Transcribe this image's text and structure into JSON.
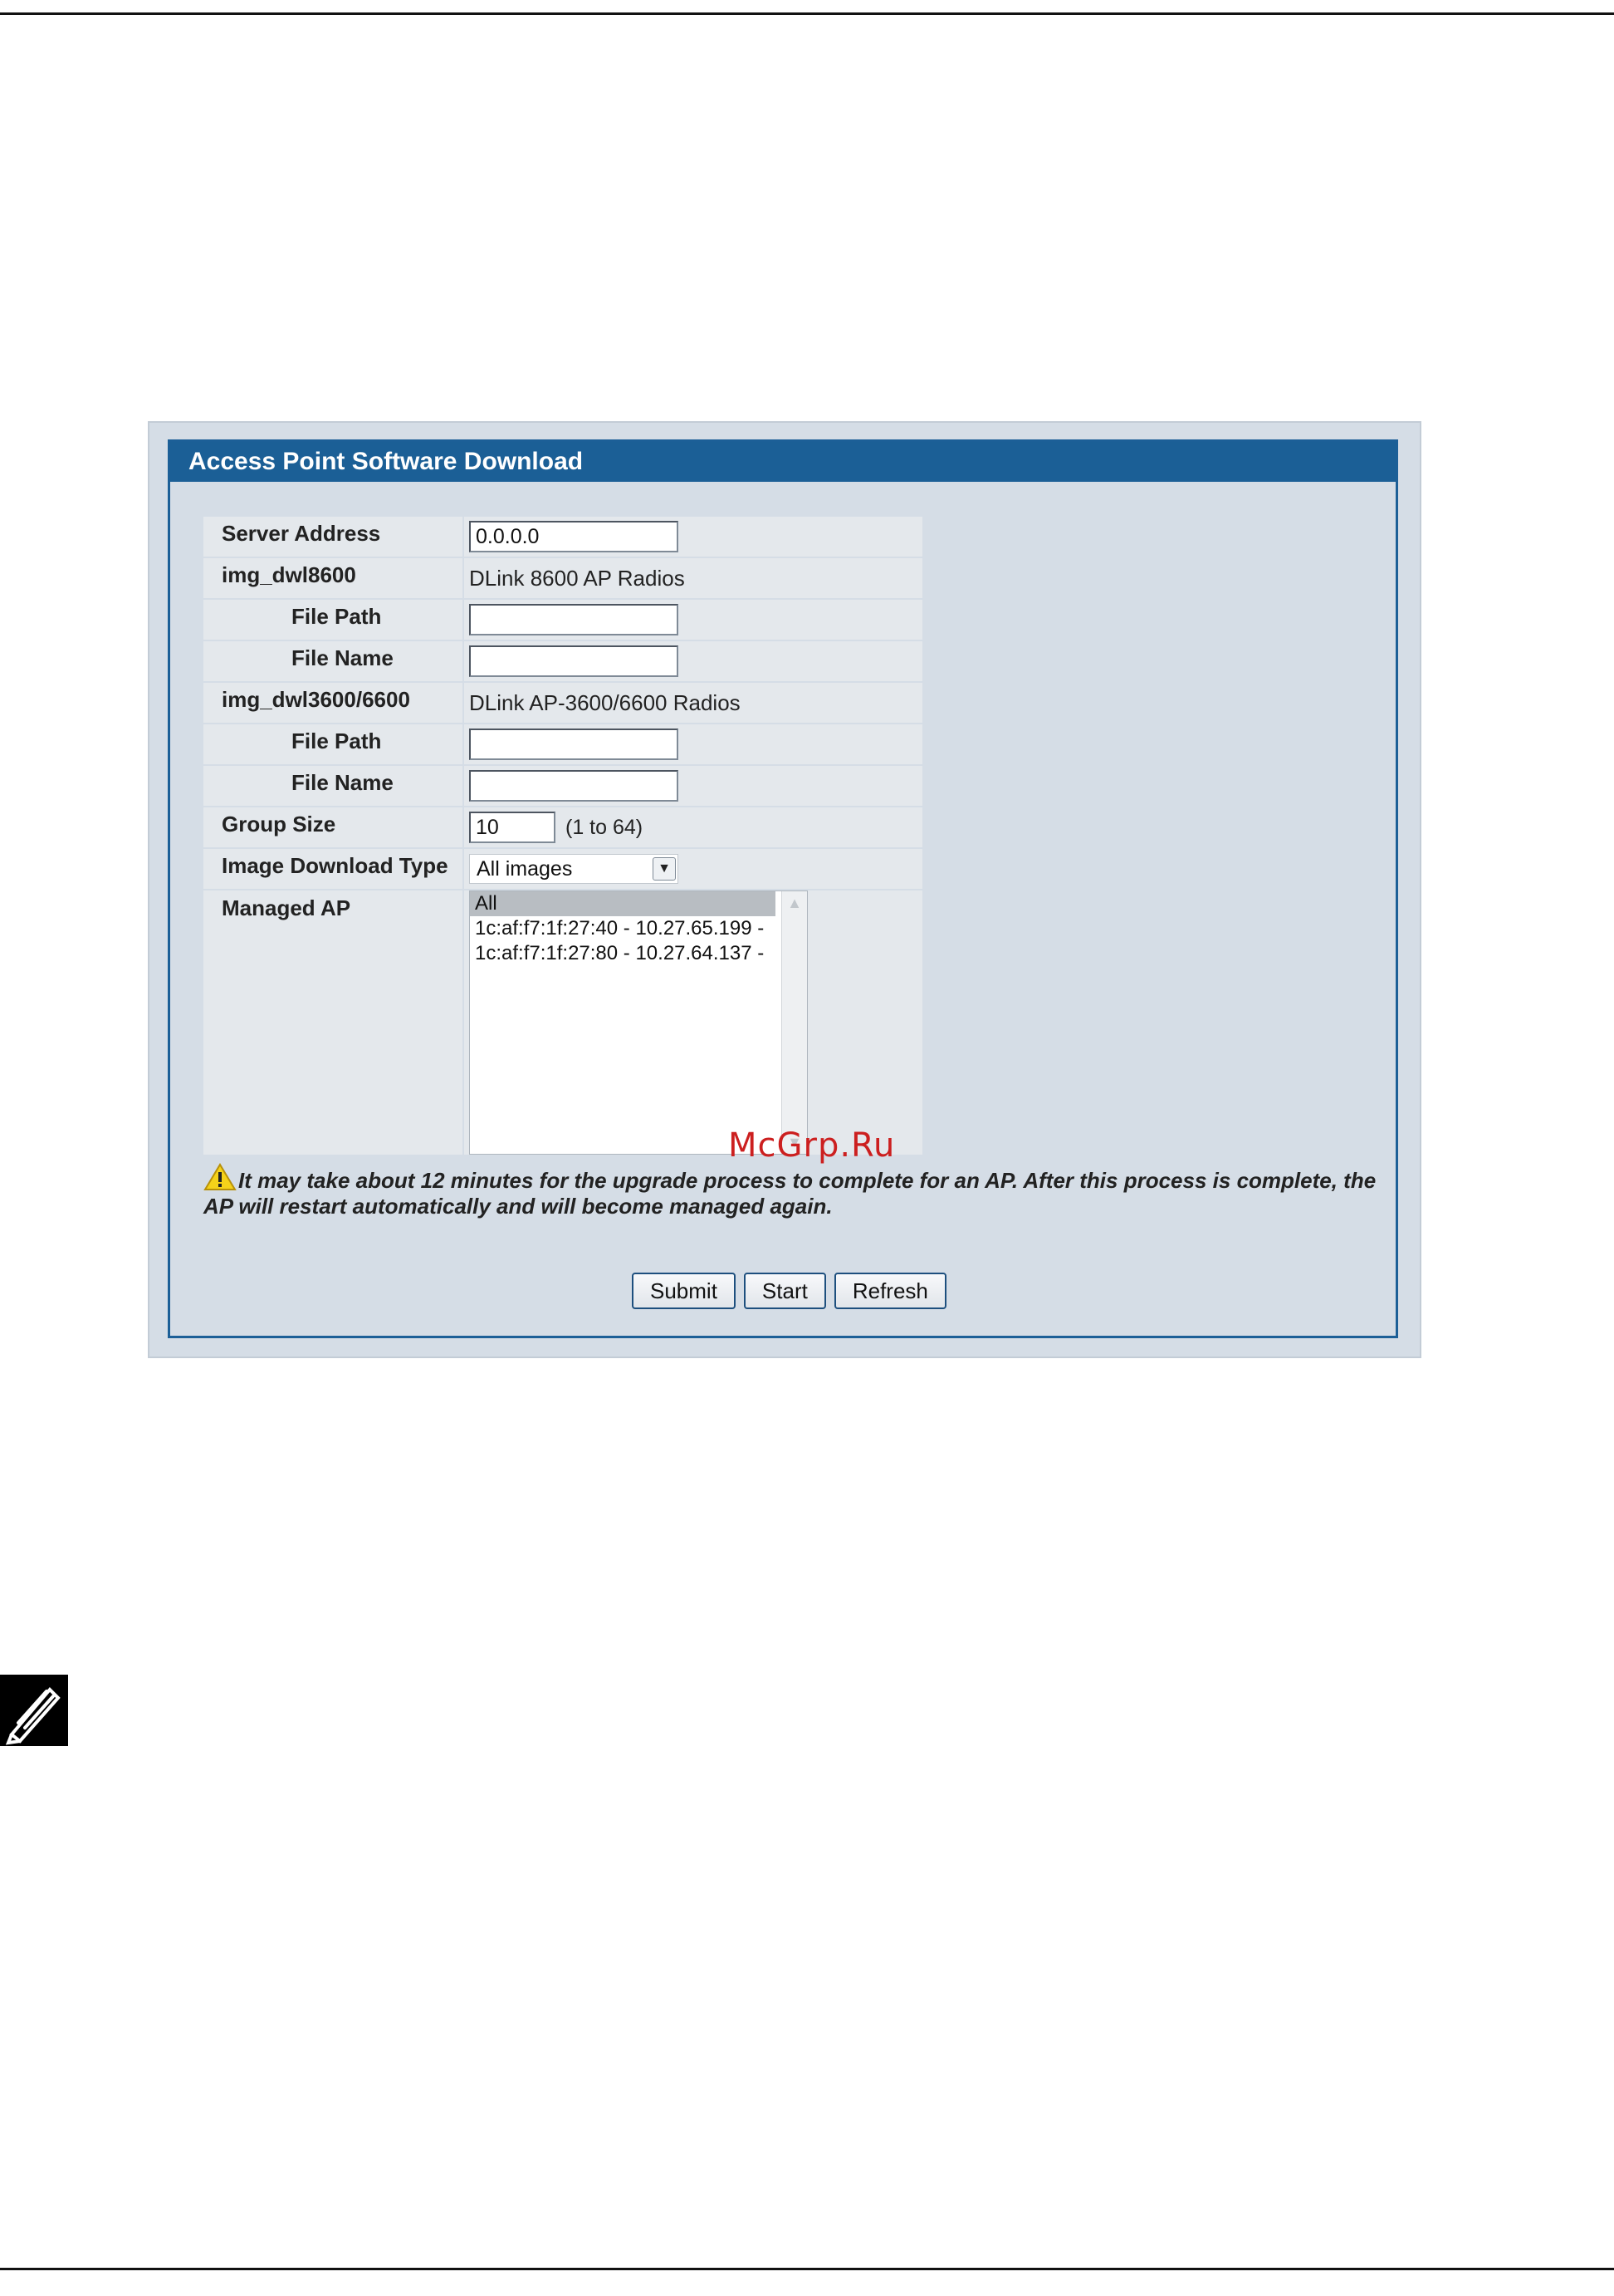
{
  "panel": {
    "title": "Access Point Software Download"
  },
  "form": {
    "server_address": {
      "label": "Server Address",
      "value": "0.0.0.0"
    },
    "img_dwl8600": {
      "label": "img_dwl8600",
      "description": "DLink 8600 AP Radios",
      "file_path_label": "File Path",
      "file_path_value": "",
      "file_name_label": "File Name",
      "file_name_value": ""
    },
    "img_dwl3600": {
      "label": "img_dwl3600/6600",
      "description": "DLink AP-3600/6600 Radios",
      "file_path_label": "File Path",
      "file_path_value": "",
      "file_name_label": "File Name",
      "file_name_value": ""
    },
    "group_size": {
      "label": "Group Size",
      "value": "10",
      "hint": "(1 to 64)"
    },
    "image_download_type": {
      "label": "Image Download Type",
      "selected": "All images"
    },
    "managed_ap": {
      "label": "Managed AP",
      "options": [
        "All",
        "1c:af:f7:1f:27:40 - 10.27.65.199 -",
        "1c:af:f7:1f:27:80 - 10.27.64.137 -"
      ],
      "selected_index": 0
    }
  },
  "warning": {
    "text": "It may take about 12 minutes for the upgrade process to complete for an AP. After this process is complete, the AP will restart automatically and will become managed again.",
    "icon": "warning-icon"
  },
  "buttons": {
    "submit": "Submit",
    "start": "Start",
    "refresh": "Refresh"
  },
  "watermark": "McGrp.Ru",
  "icons": {
    "note": "pencil-note-icon",
    "dropdown": "chevron-down-icon"
  }
}
